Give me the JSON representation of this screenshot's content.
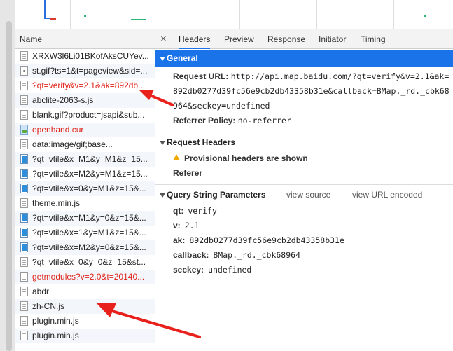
{
  "overview": {},
  "list": {
    "header": "Name",
    "rows": [
      {
        "label": "XRXW3l6Li01BKofAksCUYev...",
        "icon": "doc",
        "error": false
      },
      {
        "label": "st.gif?ts=1&t=pageview&sid=...",
        "icon": "gif",
        "error": false
      },
      {
        "label": "?qt=verify&v=2.1&ak=892db...",
        "icon": "doc",
        "error": true
      },
      {
        "label": "abclite-2063-s.js",
        "icon": "doc",
        "error": false
      },
      {
        "label": "blank.gif?product=jsapi&sub...",
        "icon": "doc",
        "error": false
      },
      {
        "label": "openhand.cur",
        "icon": "cur",
        "error": true
      },
      {
        "label": "data:image/gif;base...",
        "icon": "doc",
        "error": false
      },
      {
        "label": "?qt=vtile&x=M1&y=M1&z=15...",
        "icon": "img",
        "error": false
      },
      {
        "label": "?qt=vtile&x=M2&y=M1&z=15...",
        "icon": "img",
        "error": false
      },
      {
        "label": "?qt=vtile&x=0&y=M1&z=15&...",
        "icon": "img",
        "error": false
      },
      {
        "label": "theme.min.js",
        "icon": "doc",
        "error": false
      },
      {
        "label": "?qt=vtile&x=M1&y=0&z=15&...",
        "icon": "img",
        "error": false
      },
      {
        "label": "?qt=vtile&x=1&y=M1&z=15&...",
        "icon": "img",
        "error": false
      },
      {
        "label": "?qt=vtile&x=M2&y=0&z=15&...",
        "icon": "img",
        "error": false
      },
      {
        "label": "?qt=vtile&x=0&y=0&z=15&st...",
        "icon": "doc",
        "error": false
      },
      {
        "label": "getmodules?v=2.0&t=20140...",
        "icon": "doc",
        "error": true
      },
      {
        "label": "abdr",
        "icon": "doc",
        "error": false
      },
      {
        "label": "zh-CN.js",
        "icon": "doc",
        "error": false
      },
      {
        "label": "plugin.min.js",
        "icon": "doc",
        "error": false
      },
      {
        "label": "plugin.min.js",
        "icon": "doc",
        "error": false
      }
    ]
  },
  "tabs": {
    "close": "×",
    "items": [
      "Headers",
      "Preview",
      "Response",
      "Initiator",
      "Timing"
    ],
    "active": "Headers"
  },
  "general": {
    "title": "General",
    "request_url_key": "Request URL:",
    "request_url_value": "http://api.map.baidu.com/?qt=verify&v=2.1&ak=892db0277d39fc56e9cb2db43358b31e&callback=BMap._rd._cbk68964&seckey=undefined",
    "referrer_policy_key": "Referrer Policy:",
    "referrer_policy_value": "no-referrer"
  },
  "request_headers": {
    "title": "Request Headers",
    "warning": "Provisional headers are shown",
    "referer_key": "Referer"
  },
  "query_string": {
    "title": "Query String Parameters",
    "view_source": "view source",
    "view_url_encoded": "view URL encoded",
    "params": [
      {
        "key": "qt:",
        "value": "verify"
      },
      {
        "key": "v:",
        "value": "2.1"
      },
      {
        "key": "ak:",
        "value": "892db0277d39fc56e9cb2db43358b31e"
      },
      {
        "key": "callback:",
        "value": "BMap._rd._cbk68964"
      },
      {
        "key": "seckey:",
        "value": "undefined"
      }
    ]
  },
  "colors": {
    "accent": "#1a73e8",
    "error_text": "#e0241b",
    "annotation_arrow": "#e8211d"
  }
}
